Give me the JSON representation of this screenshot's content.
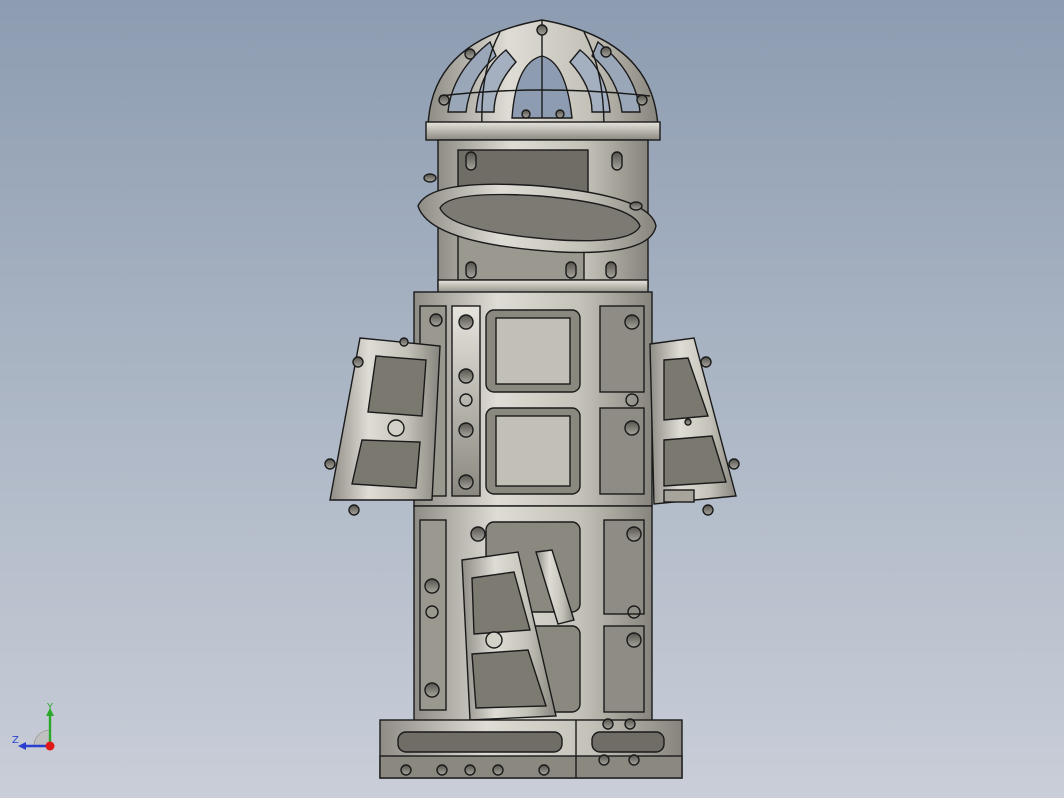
{
  "viewport": {
    "background_top": "#8d9cb1",
    "background_bottom": "#c9ced8"
  },
  "model": {
    "metal_color": "#c8c6bc",
    "shadow_color": "#6e6c66",
    "edge_color": "#1a1a1a"
  },
  "triad": {
    "y_label": "Y",
    "z_label": "Z",
    "y_color": "#2ba82b",
    "z_color": "#2a3fd0",
    "x_color": "#e01818"
  }
}
